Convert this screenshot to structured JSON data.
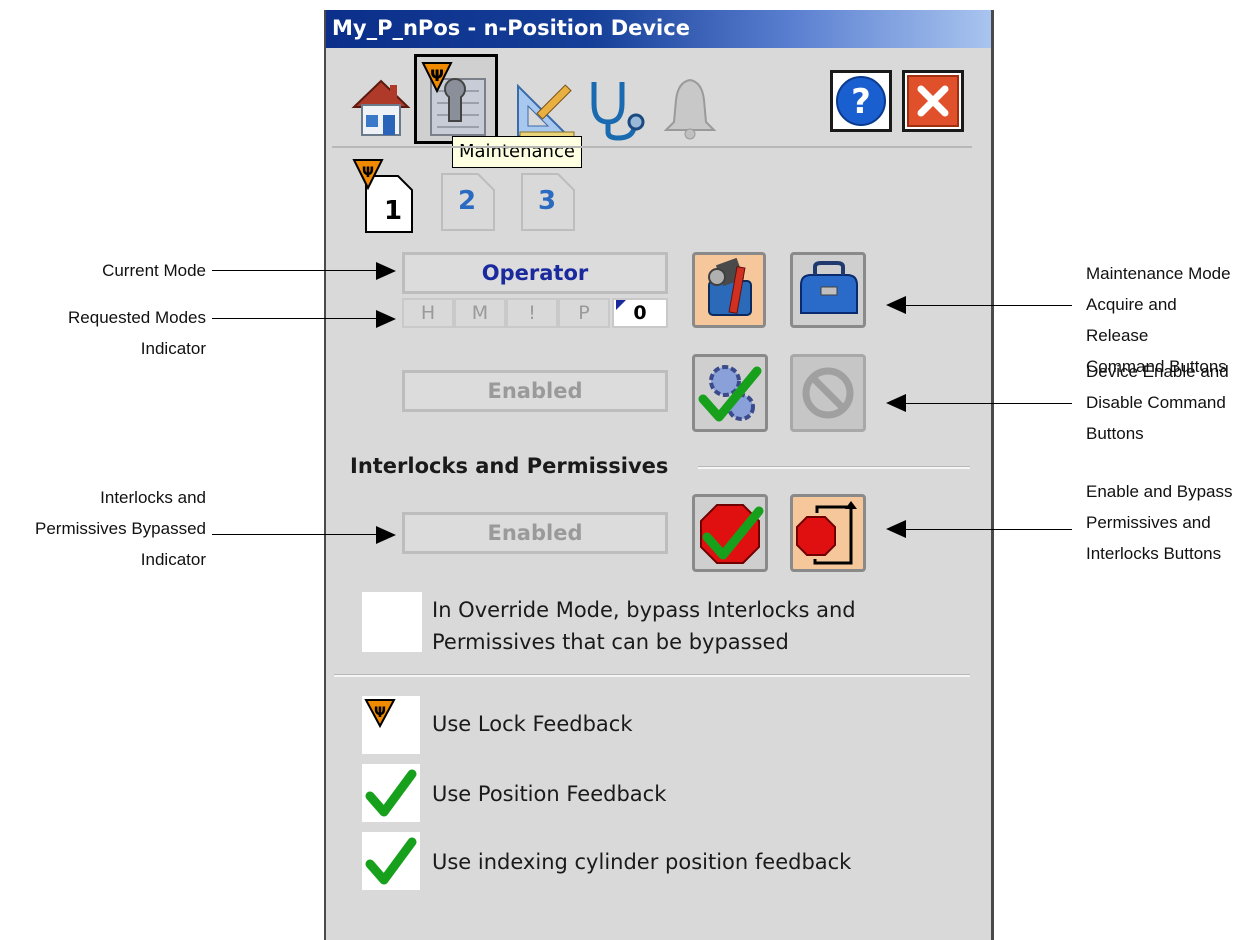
{
  "window": {
    "title": "My_P_nPos - n-Position Device"
  },
  "toolbar": {
    "tabs": [
      {
        "name": "home",
        "icon": "home-icon"
      },
      {
        "name": "maintenance",
        "icon": "maintenance-icon",
        "active": true
      },
      {
        "name": "engineering",
        "icon": "engineering-icon"
      },
      {
        "name": "diagnostics",
        "icon": "stethoscope-icon"
      },
      {
        "name": "alarms",
        "icon": "bell-icon"
      }
    ],
    "tooltip": "Maintenance",
    "help_icon": "help-icon",
    "close_icon": "close-icon"
  },
  "pages": [
    "1",
    "2",
    "3"
  ],
  "mode": {
    "current": "Operator",
    "requested": [
      "H",
      "M",
      "!",
      "P"
    ],
    "requested_count": "0",
    "device_state": "Enabled"
  },
  "interlocks": {
    "heading": "Interlocks and Permissives",
    "bypass_state": "Enabled",
    "override_text_line1": "In Override Mode, bypass Interlocks and",
    "override_text_line2": "Permissives that can be bypassed"
  },
  "options": [
    {
      "label": "Use Lock Feedback",
      "state": "locked"
    },
    {
      "label": "Use Position Feedback",
      "state": "checked"
    },
    {
      "label": "Use indexing cylinder position feedback",
      "state": "checked"
    }
  ],
  "callouts": {
    "current_mode": "Current Mode",
    "requested_modes": "Requested Modes Indicator",
    "interlocks_bypassed": [
      "Interlocks and",
      "Permissives Bypassed",
      "Indicator"
    ],
    "maint_mode": [
      "Maintenance Mode",
      "Acquire and Release",
      "Command Buttons"
    ],
    "device_enable": [
      "Device Enable and",
      "Disable Command",
      "Buttons"
    ],
    "enable_bypass": [
      "Enable and Bypass",
      "Permissives and",
      "Interlocks Buttons"
    ]
  },
  "colors": {
    "title_bar": "#0b2f8a",
    "mode_text": "#1a2a9e",
    "orange_button": "#f6c79a",
    "check_green": "#17a01c",
    "stop_red": "#e01010"
  }
}
